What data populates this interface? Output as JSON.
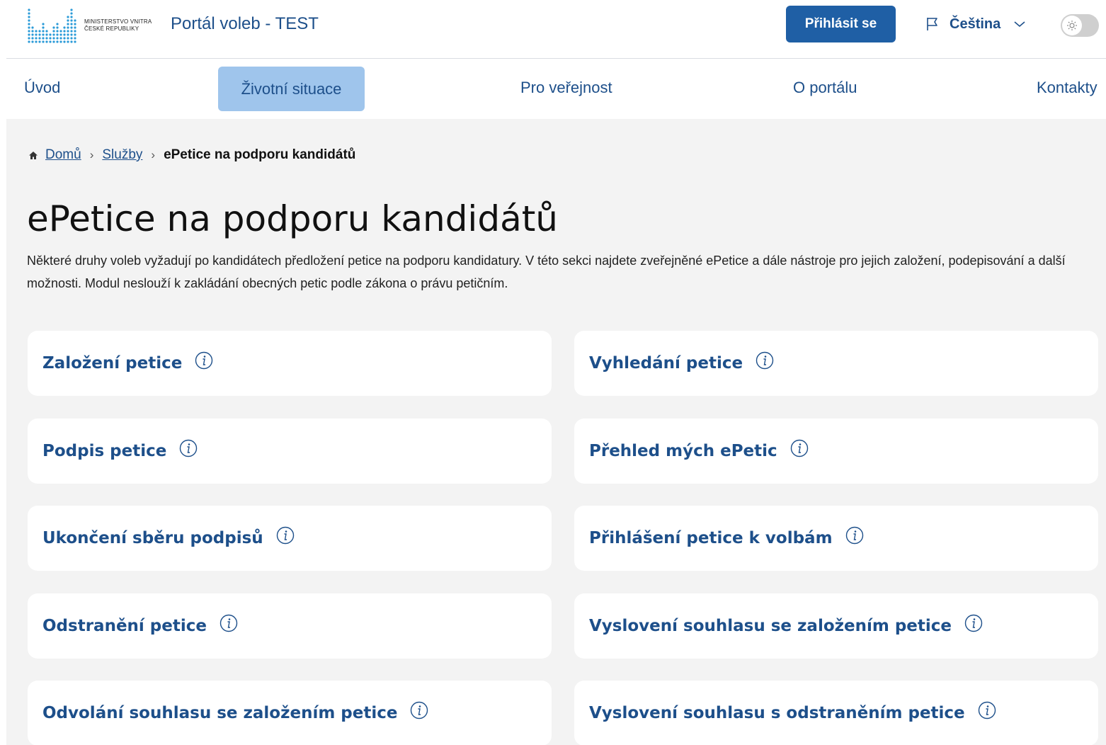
{
  "header": {
    "logo_line1": "MINISTERSTVO VNITRA",
    "logo_line2": "ČESKÉ REPUBLIKY",
    "portal_title": "Portál voleb - TEST",
    "login_label": "Přihlásit se",
    "language_label": "Čeština",
    "icons": {
      "flag": "flag-icon",
      "chevron": "chevron-down-icon",
      "theme": "sun-icon"
    }
  },
  "nav": {
    "items": [
      "Úvod",
      "Životní situace",
      "Pro veřejnost",
      "O portálu",
      "Kontakty"
    ],
    "active_index": 1
  },
  "breadcrumb": {
    "home_label": "Domů",
    "services_label": "Služby",
    "current_label": "ePetice na podporu kandidátů"
  },
  "page": {
    "title": "ePetice na podporu kandidátů",
    "intro": "Některé druhy voleb vyžadují po kandidátech předložení petice na podporu kandidatury. V této sekci najdete zveřejněné ePetice a dále nástroje pro jejich založení, podepisování a další možnosti. Modul neslouží k zakládání obecných petic podle zákona o právu petičním."
  },
  "cards": [
    "Založení petice",
    "Vyhledání petice",
    "Podpis petice",
    "Přehled mých ePetic",
    "Ukončení sběru podpisů",
    "Přihlášení petice k volbám",
    "Odstranění petice",
    "Vyslovení souhlasu se založením petice",
    "Odvolání souhlasu se založením petice",
    "Vyslovení souhlasu s odstraněním petice"
  ],
  "colors": {
    "brand_blue": "#1f5fa5",
    "link_blue": "#1d4f8a",
    "nav_active_bg": "#9fc5ec",
    "content_bg": "#f3f3f3"
  }
}
